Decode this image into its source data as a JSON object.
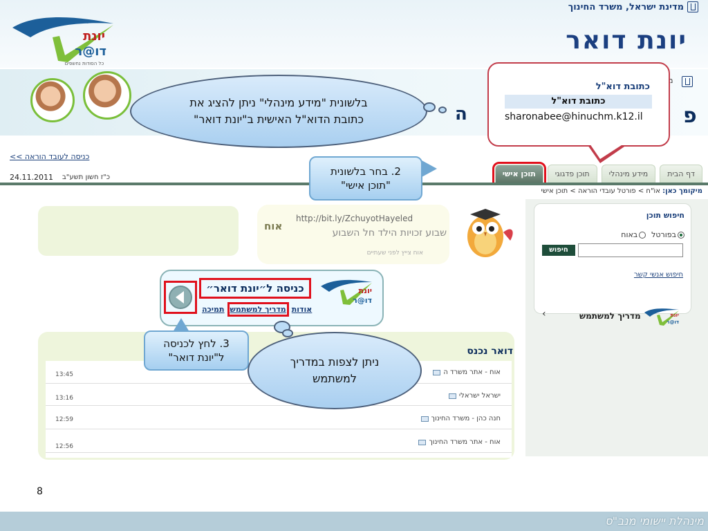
{
  "header": {
    "ministry": "מדינת ישראל, משרד החינוך",
    "title": "יונת דואר",
    "logo_top": "יונת",
    "logo_bottom": "דו@ר",
    "logo_caption": "כל הסודות נחשפים"
  },
  "banner": {
    "partial_text": "ה",
    "partial_ma": "מ",
    "partial_p": "פ"
  },
  "topbar": {
    "teacher_link": "כניסה לעובד הוראה >>",
    "hebrew_date": "כ\"ז חשון תשע\"ב",
    "greg_date": "24.11.2011"
  },
  "tabs": [
    {
      "label": "דף הבית"
    },
    {
      "label": "מידע מינהלי"
    },
    {
      "label": "תוכן פדגוגי"
    },
    {
      "label": "תוכן אישי"
    }
  ],
  "breadcrumb": {
    "prefix": "מיקומך כאן:",
    "path": "אוֹ\"ח > פורטל עובדי הוראה > תוכן אישי"
  },
  "sidebar": {
    "search_title": "חיפוש תוכן",
    "radio_portal": "בפורטל",
    "radio_web": "באוח",
    "search_button": "חיפוש",
    "contacts_link": "חיפוש אנשי קשר",
    "guide_label": "מדריך למשתמש",
    "guide_arrow": "‹"
  },
  "tweet": {
    "url": "http://bit.ly/ZchuyotHayeled",
    "text": "שבוע זכויות הילד חל השבוע",
    "time": "אוח צייץ לפני שעתיים",
    "oth_logo": "אוח"
  },
  "entry": {
    "title": "כניסה ל״יונת דואר״",
    "links": [
      "אודות",
      "מדריך למשתמש",
      "תמיכה"
    ]
  },
  "mail": {
    "title": "דואר נכנס",
    "rows": [
      {
        "sender": "אוח - אתר משרד ה",
        "time": "13:45"
      },
      {
        "sender": "ישראל ישראלי",
        "time": "13:16"
      },
      {
        "sender": "חנה כהן - משרד החינוך",
        "time": "12:59"
      },
      {
        "sender": "אוח - אתר משרד החינוך",
        "time": "12:56"
      }
    ]
  },
  "callouts": {
    "cloud_1": "בלשונית \"מידע מינהלי\" ניתן להציג את כתובת הדוא\"ל האישית ב\"יונת דואר\"",
    "step_2": "2. בחר בלשונית \"תוכן אישי\"",
    "step_3": "3. לחץ לכניסה ל\"יונת דואר\"",
    "cloud_2": "ניתן לצפות במדריך למשתמש"
  },
  "address_box": {
    "header": "כתובת דוא\"ל",
    "label": "כתובת דוא\"ל",
    "value": "sharonabee@hinuchm.k12.il"
  },
  "footer": {
    "page_number": "8",
    "text": "מינהלת יישומי מנב\"ס"
  },
  "colors": {
    "brand_blue": "#1b3f80",
    "highlight_red": "#e0101c",
    "footer_bg": "#b5cdd9"
  }
}
